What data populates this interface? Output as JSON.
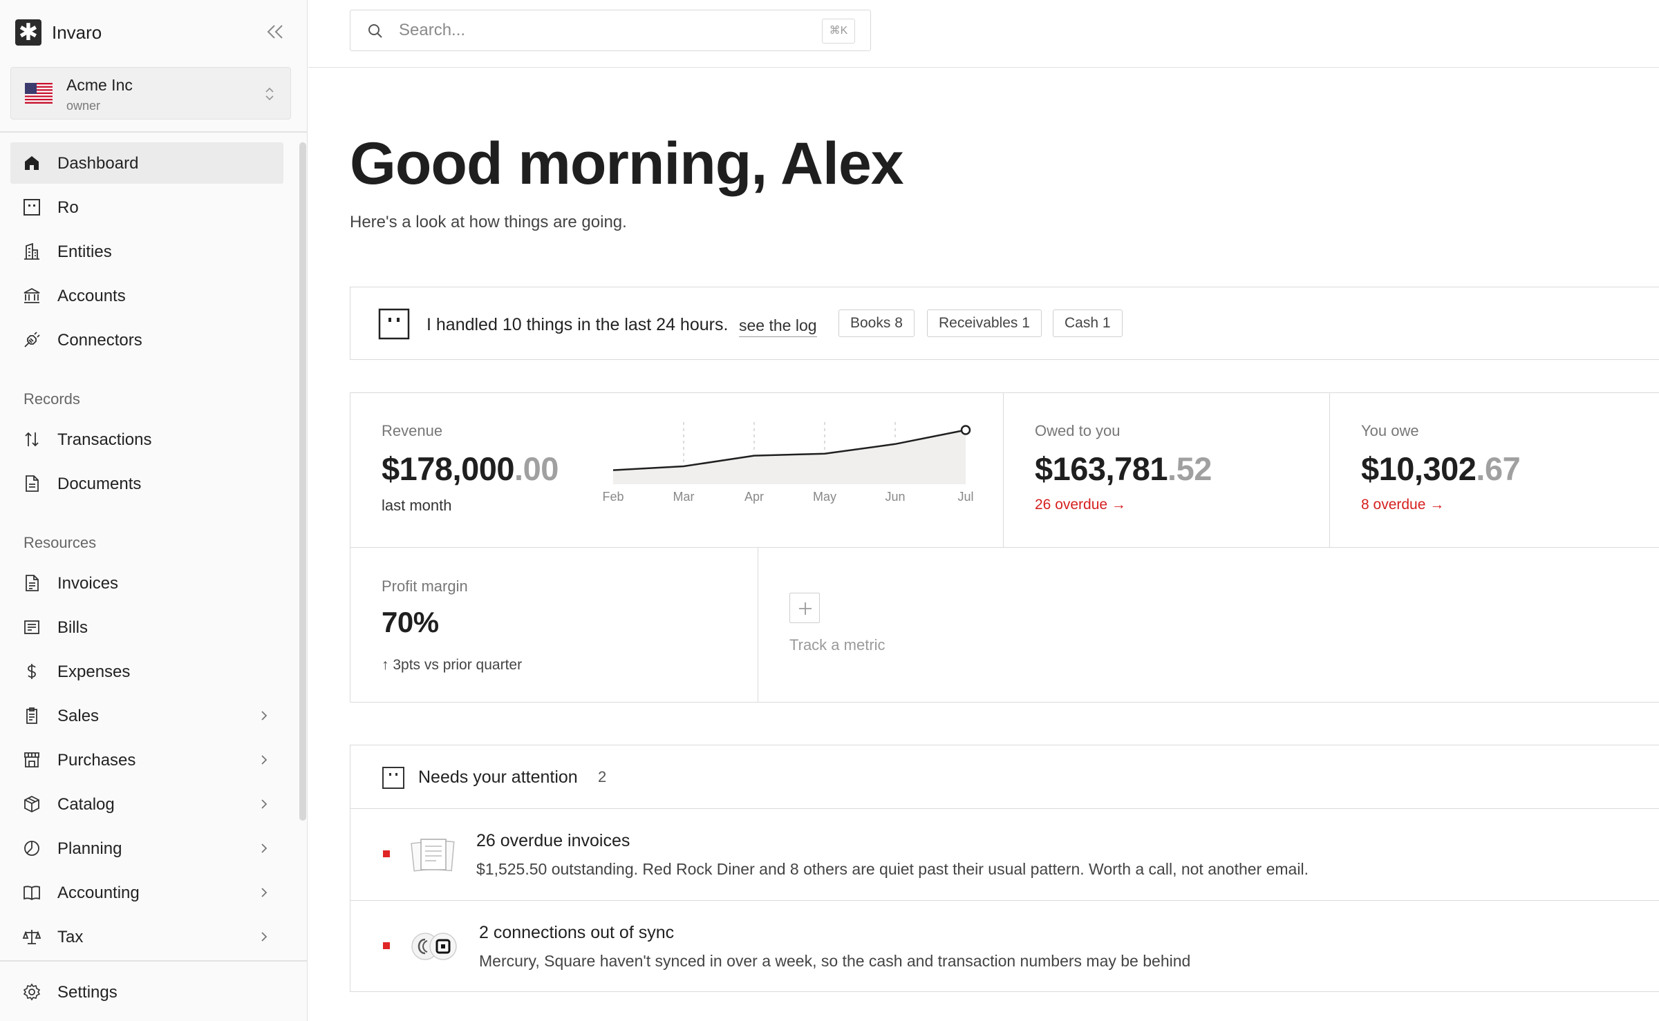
{
  "sidebar": {
    "brand": "Invaro",
    "org": {
      "name": "Acme Inc",
      "role": "owner"
    },
    "nav_main": [
      {
        "label": "Dashboard",
        "icon": "home-icon"
      },
      {
        "label": "Ro",
        "icon": "bot-square-icon"
      },
      {
        "label": "Entities",
        "icon": "building-icon"
      },
      {
        "label": "Accounts",
        "icon": "bank-icon"
      },
      {
        "label": "Connectors",
        "icon": "plug-icon"
      }
    ],
    "records_label": "Records",
    "records": [
      {
        "label": "Transactions",
        "icon": "arrows-updown-icon"
      },
      {
        "label": "Documents",
        "icon": "document-icon"
      }
    ],
    "resources_label": "Resources",
    "resources": [
      {
        "label": "Invoices",
        "icon": "invoice-icon"
      },
      {
        "label": "Bills",
        "icon": "bill-icon"
      },
      {
        "label": "Expenses",
        "icon": "dollar-icon"
      },
      {
        "label": "Sales",
        "icon": "clipboard-icon"
      },
      {
        "label": "Purchases",
        "icon": "store-icon"
      },
      {
        "label": "Catalog",
        "icon": "box-icon"
      },
      {
        "label": "Planning",
        "icon": "pie-icon"
      },
      {
        "label": "Accounting",
        "icon": "book-icon"
      },
      {
        "label": "Tax",
        "icon": "scale-icon"
      }
    ],
    "settings_label": "Settings"
  },
  "search": {
    "placeholder": "Search...",
    "shortcut": "⌘K"
  },
  "greeting": {
    "title": "Good morning, Alex",
    "subtitle": "Here's a look at how things are going."
  },
  "banner": {
    "text": "I handled 10 things in the last 24 hours.",
    "link": "see the log",
    "chips": [
      "Books 8",
      "Receivables 1",
      "Cash 1"
    ]
  },
  "metrics": {
    "revenue": {
      "label": "Revenue",
      "dollars": "$178,000",
      "cents": ".00",
      "note": "last month"
    },
    "owed_to_you": {
      "label": "Owed to you",
      "dollars": "$163,781",
      "cents": ".52",
      "overdue": "26 overdue →"
    },
    "you_owe": {
      "label": "You owe",
      "dollars": "$10,302",
      "cents": ".67",
      "overdue": "8 overdue →"
    },
    "profit_margin": {
      "label": "Profit margin",
      "value": "70%",
      "note": "↑ 3pts vs prior quarter"
    },
    "track_label": "Track a metric"
  },
  "chart_data": {
    "type": "area",
    "categories": [
      "Feb",
      "Mar",
      "Apr",
      "May",
      "Jun",
      "Jul"
    ],
    "values": [
      0.12,
      0.2,
      0.42,
      0.46,
      0.66,
      0.95
    ],
    "highlight_last": true
  },
  "attention": {
    "title": "Needs your attention",
    "count": "2",
    "items": [
      {
        "title": "26 overdue invoices",
        "description": "$1,525.50 outstanding. Red Rock Diner and 8 others are quiet past their usual pattern. Worth a call, not another email."
      },
      {
        "title": "2 connections out of sync",
        "description": "Mercury, Square haven't synced in over a week, so the cash and transaction numbers may be behind"
      }
    ]
  },
  "colors": {
    "accent_red": "#d61f1f",
    "text": "#1f1f1f",
    "border": "#dadada"
  }
}
